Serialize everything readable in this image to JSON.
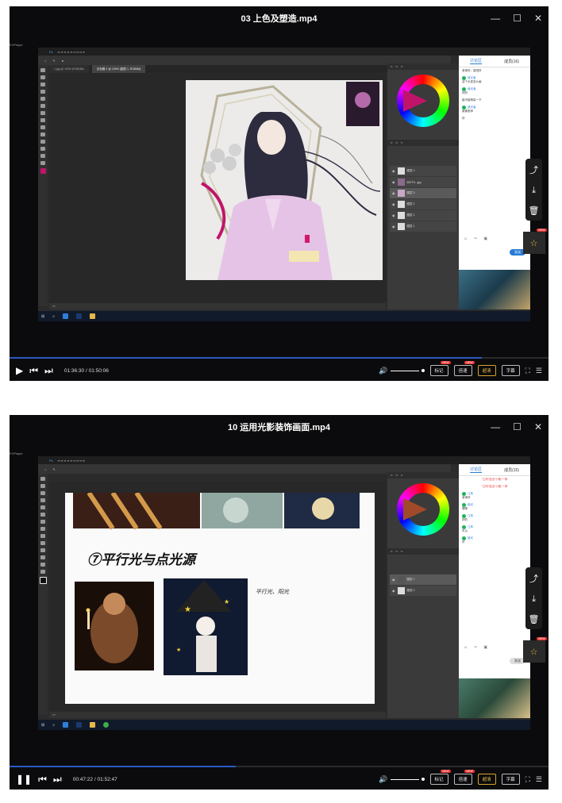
{
  "player1": {
    "title": "03 上色及塑造.mp4",
    "brand": "EVPlayer",
    "ps_tabs": [
      "1.jpg @ 100% (RGB/8#)",
      "无标题-1 @ 100% (图层 1, RGB/8#)"
    ],
    "layers": [
      "图层 0",
      "6B7F4...jpg",
      "图层 3",
      "图层 2",
      "图层 1",
      "图层 1"
    ],
    "chat": {
      "tabs": [
        "讨论区",
        "成员(16)"
      ],
      "messages": [
        {
          "user": "",
          "text": "老师好，感觉好"
        },
        {
          "user": "追光者",
          "text": "这个头发怎么画"
        },
        {
          "user": "追光者",
          "text": "好的"
        },
        {
          "user": "",
          "text": "能不能再讲一下"
        },
        {
          "user": "追光者",
          "text": "谢谢老师"
        },
        {
          "user": "",
          "text": "好"
        }
      ],
      "send": "发送"
    },
    "time_elapsed": "01:36:30",
    "time_total": "01:50:06",
    "progress": 0.877
  },
  "player2": {
    "title": "10 运用光影装饰画面.mp4",
    "brand": "EVPlayer",
    "handwriting_title": "⑦平行光与点光源",
    "handwriting_note": "平行光、阳光",
    "layers": [
      "图层 1",
      "图层 0"
    ],
    "chat": {
      "tabs": [
        "讨论区",
        "成员(15)"
      ],
      "system": [
        "\"江风\"送出\"小鱼\"一条",
        "\"江风\"送出\"小鱼\"一条"
      ],
      "messages": [
        {
          "user": "江风",
          "text": "老师好"
        },
        {
          "user": "追光",
          "text": "嗯嗯"
        },
        {
          "user": "江风",
          "text": "好的"
        },
        {
          "user": "江风",
          "text": "可以"
        },
        {
          "user": "追光",
          "text": "好"
        }
      ],
      "send": "发送"
    },
    "time_elapsed": "00:47:22",
    "time_total": "01:52:47",
    "progress": 0.42
  },
  "controls": {
    "pills": [
      "标记",
      "倍速",
      "超清",
      "字幕"
    ],
    "new_badge": "NEW"
  },
  "colors": {
    "player_bg": "#0b0b0d",
    "accent_blue": "#2b59c3",
    "gold": "#d6a42a",
    "chat_accent": "#2a7bd4"
  }
}
